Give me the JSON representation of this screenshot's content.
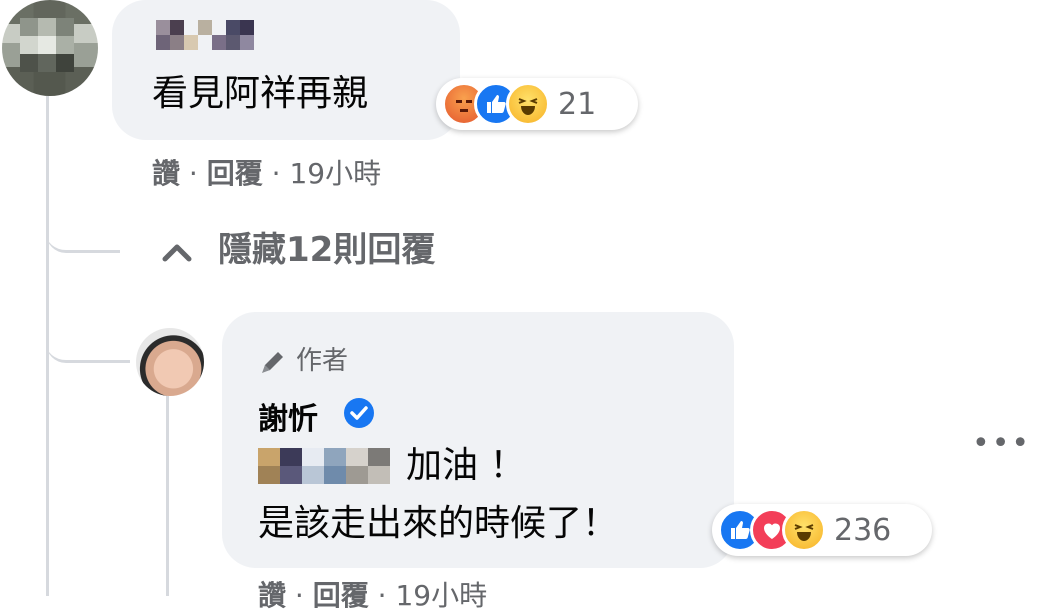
{
  "comment1": {
    "text": "看見阿祥再親",
    "reaction_count": "21",
    "reactions": [
      "angry-icon",
      "like-icon",
      "haha-icon"
    ],
    "actions": {
      "like": "讚",
      "reply": "回覆",
      "time": "19小時"
    }
  },
  "thread": {
    "hide_replies": "隱藏12則回覆"
  },
  "reply1": {
    "badge": "作者",
    "author": "謝忻",
    "line1": "加油 ！",
    "line2": "是該走出來的時候了！",
    "reaction_count": "236",
    "reactions": [
      "like-icon",
      "love-icon",
      "haha-icon"
    ],
    "actions": {
      "like": "讚",
      "reply": "回覆",
      "time": "19小時"
    }
  },
  "colors": {
    "accent": "#1877f2",
    "bubble": "#f0f2f5",
    "meta": "#65676b"
  }
}
